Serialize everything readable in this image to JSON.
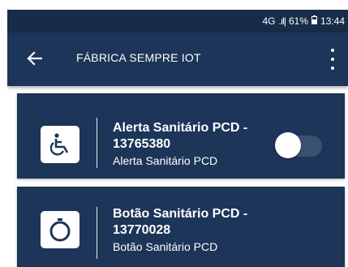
{
  "status_bar": {
    "network": "4G",
    "signal": ".ıl|",
    "battery": "61%",
    "time": "13:44"
  },
  "app_bar": {
    "title": "FÁBRICA SEMPRE IOT",
    "back_icon": "arrow-back-icon",
    "menu_icon": "more-vert-icon"
  },
  "devices": [
    {
      "name": "Alerta Sanitário PCD - 13765380",
      "type": "Alerta Sanitário PCD",
      "icon": "wheelchair-icon",
      "toggle": false
    },
    {
      "name": "Botão Sanitário PCD - 13770028",
      "type": "Botão Sanitário PCD",
      "icon": "button-icon"
    }
  ],
  "colors": {
    "status_bar": "#162c49",
    "primary": "#1c3558",
    "card": "#1c3558",
    "toggle_track": "#3a5172",
    "text": "#ffffff"
  }
}
